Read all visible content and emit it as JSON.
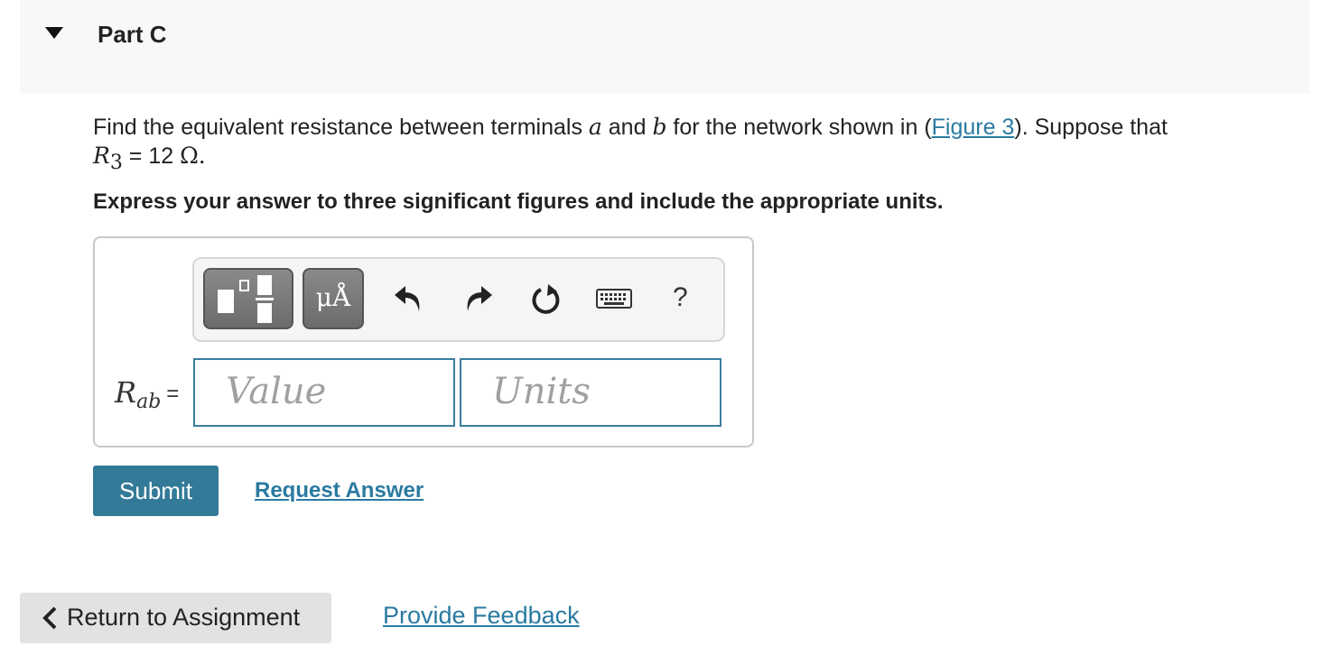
{
  "part": {
    "title": "Part C"
  },
  "question": {
    "text_before_a": "Find the equivalent resistance between terminals ",
    "var_a": "a",
    "text_and": " and ",
    "var_b": "b",
    "text_before_link": " for the network shown in (",
    "figure_link": "Figure 3",
    "text_after_link": "). Suppose that",
    "r3_var": "R",
    "r3_sub": "3",
    "r3_eq": " = 12 ",
    "r3_unit": "Ω."
  },
  "instruction": "Express your answer to three significant figures and include the appropriate units.",
  "toolbar": {
    "templates_icon": "templates-icon",
    "units_label": "μÅ",
    "undo_icon": "undo-icon",
    "redo_icon": "redo-icon",
    "reset_icon": "reset-icon",
    "keyboard_icon": "keyboard-icon",
    "help_label": "?"
  },
  "answer": {
    "var": "R",
    "sub": "ab",
    "eq": "=",
    "value_placeholder": "Value",
    "units_placeholder": "Units"
  },
  "actions": {
    "submit_label": "Submit",
    "request_label": "Request Answer"
  },
  "footer": {
    "return_label": "Return to Assignment",
    "feedback_label": "Provide Feedback"
  },
  "colors": {
    "accent": "#327a98",
    "link": "#2a7aa1",
    "header_bg": "#f8f8f8"
  }
}
